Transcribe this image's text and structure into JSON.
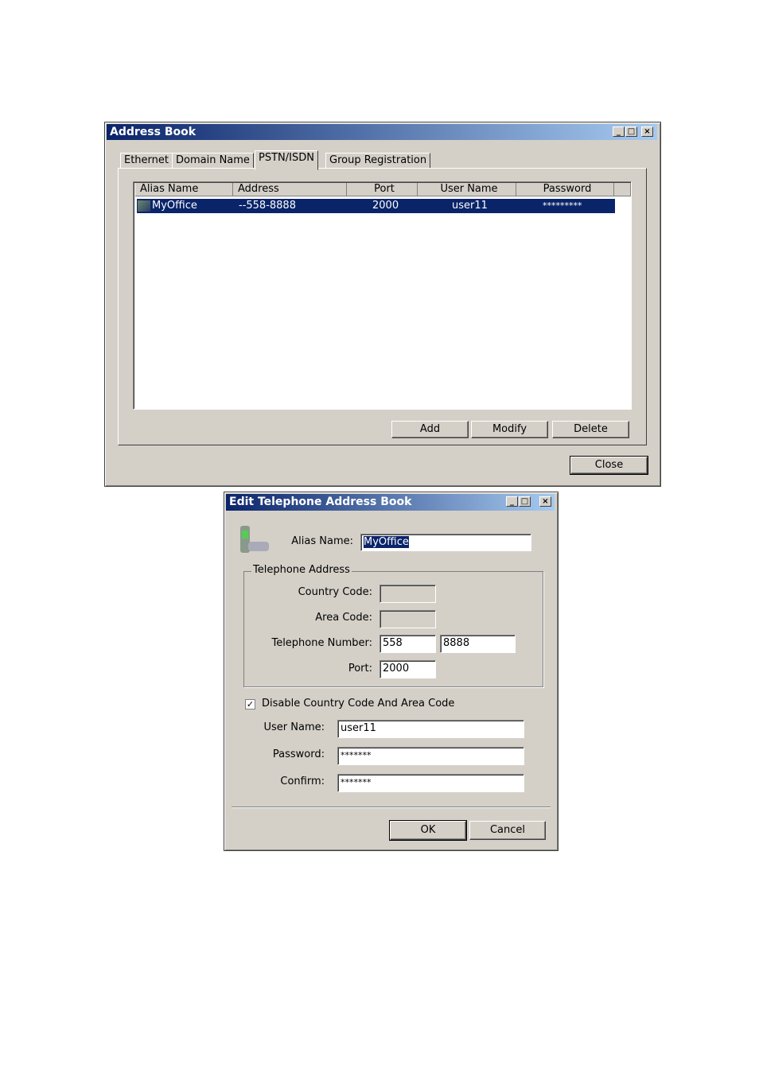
{
  "address_book": {
    "title": "Address Book",
    "tabs": [
      "Ethernet",
      "Domain Name",
      "PSTN/ISDN",
      "Group Registration"
    ],
    "active_tab": "PSTN/ISDN",
    "columns": [
      "Alias Name",
      "Address",
      "Port",
      "User Name",
      "Password"
    ],
    "rows": [
      {
        "alias": "MyOffice",
        "address": "--558-8888",
        "port": "2000",
        "user": "user11",
        "password": "*********",
        "selected": true
      }
    ],
    "buttons": {
      "add": "Add",
      "modify": "Modify",
      "delete": "Delete",
      "close": "Close"
    }
  },
  "edit_dialog": {
    "title": "Edit Telephone Address Book",
    "alias_label": "Alias Name:",
    "alias_value": "MyOffice",
    "group_label": "Telephone Address",
    "country_label": "Country Code:",
    "country_value": "",
    "area_label": "Area Code:",
    "area_value": "",
    "tel_label": "Telephone Number:",
    "tel_part1": "558",
    "tel_part2": "8888",
    "port_label": "Port:",
    "port_value": "2000",
    "disable_checkbox_label": "Disable Country Code And Area Code",
    "disable_checked": true,
    "user_label": "User Name:",
    "user_value": "user11",
    "password_label": "Password:",
    "password_value": "*******",
    "confirm_label": "Confirm:",
    "confirm_value": "*******",
    "ok": "OK",
    "cancel": "Cancel"
  },
  "colors": {
    "title_start": "#0a246a",
    "title_end": "#a6caf0",
    "selection": "#0a246a",
    "face": "#d4d0c8"
  }
}
